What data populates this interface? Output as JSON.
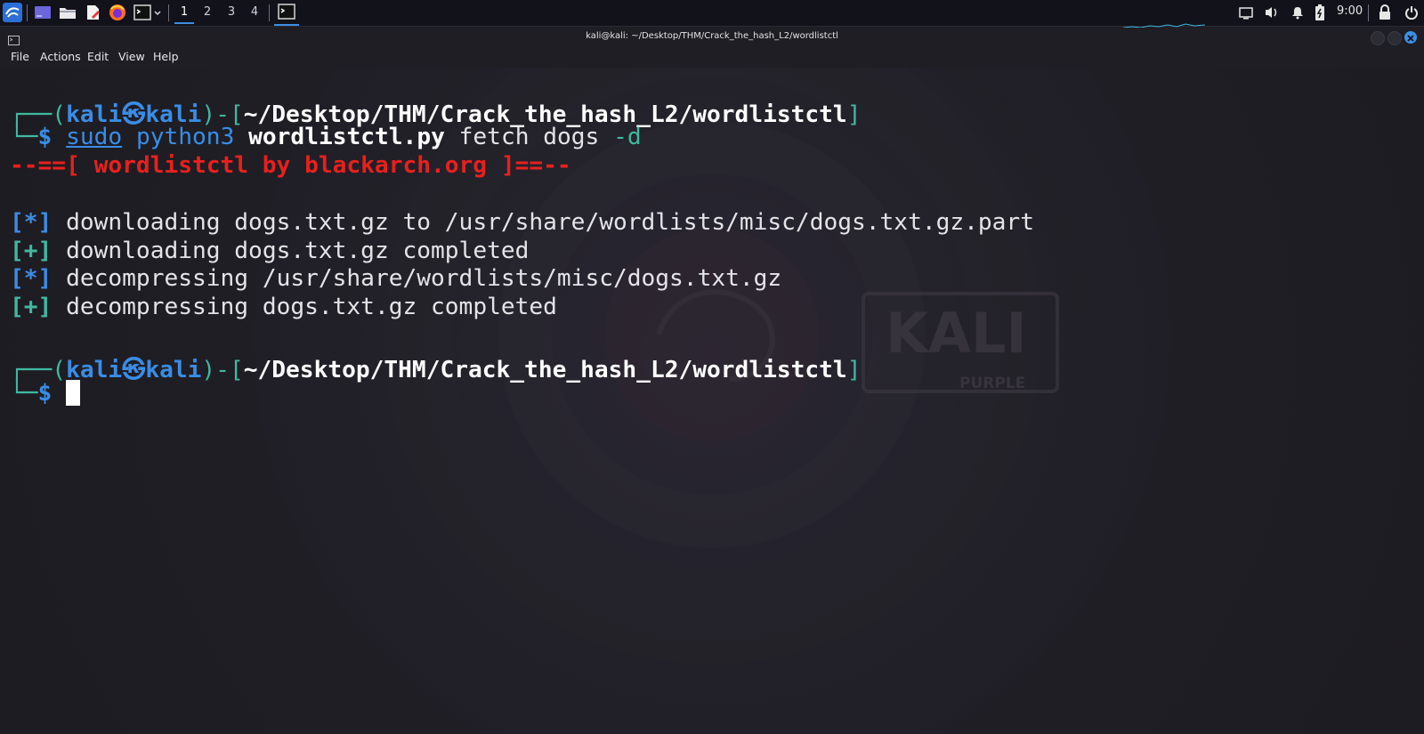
{
  "panel": {
    "workspaces": [
      "1",
      "2",
      "3",
      "4"
    ],
    "active_workspace": "1",
    "clock": "9:00"
  },
  "window": {
    "title": "kali@kali: ~/Desktop/THM/Crack_the_hash_L2/wordlistctl"
  },
  "menu": {
    "file": "File",
    "actions": "Actions",
    "edit": "Edit",
    "view": "View",
    "help": "Help"
  },
  "terminal": {
    "prompt1": {
      "frame_open": "┌──(",
      "user": "kali",
      "at": "㉿",
      "host": "kali",
      "mid": ")-[",
      "path": "~/Desktop/THM/Crack_the_hash_L2/wordlistctl",
      "close": "]"
    },
    "cmd_line": {
      "frame": "└─",
      "dollar": "$",
      "sudo": "sudo",
      "python": "python3",
      "script": "wordlistctl.py",
      "args": "fetch dogs",
      "flag": "-d"
    },
    "banner": "--==[ wordlistctl by blackarch.org ]==--",
    "outputs": [
      {
        "mark": "[*]",
        "text": "downloading dogs.txt.gz to /usr/share/wordlists/misc/dogs.txt.gz.part"
      },
      {
        "mark": "[+]",
        "text": "downloading dogs.txt.gz completed"
      },
      {
        "mark": "[*]",
        "text": "decompressing /usr/share/wordlists/misc/dogs.txt.gz"
      },
      {
        "mark": "[+]",
        "text": "decompressing dogs.txt.gz completed"
      }
    ],
    "prompt2": {
      "frame_open": "┌──(",
      "user": "kali",
      "at": "㉿",
      "host": "kali",
      "mid": ")-[",
      "path": "~/Desktop/THM/Crack_the_hash_L2/wordlistctl",
      "close": "]"
    },
    "prompt2_line": {
      "frame": "└─",
      "dollar": "$"
    }
  },
  "wallpaper": {
    "logo_text": "KALI",
    "logo_sub": "PURPLE"
  },
  "colors": {
    "prompt_blue": "#3a8de6",
    "frame_teal": "#3fb9a0",
    "banner_red": "#e8201e",
    "background": "#1f1e25"
  }
}
